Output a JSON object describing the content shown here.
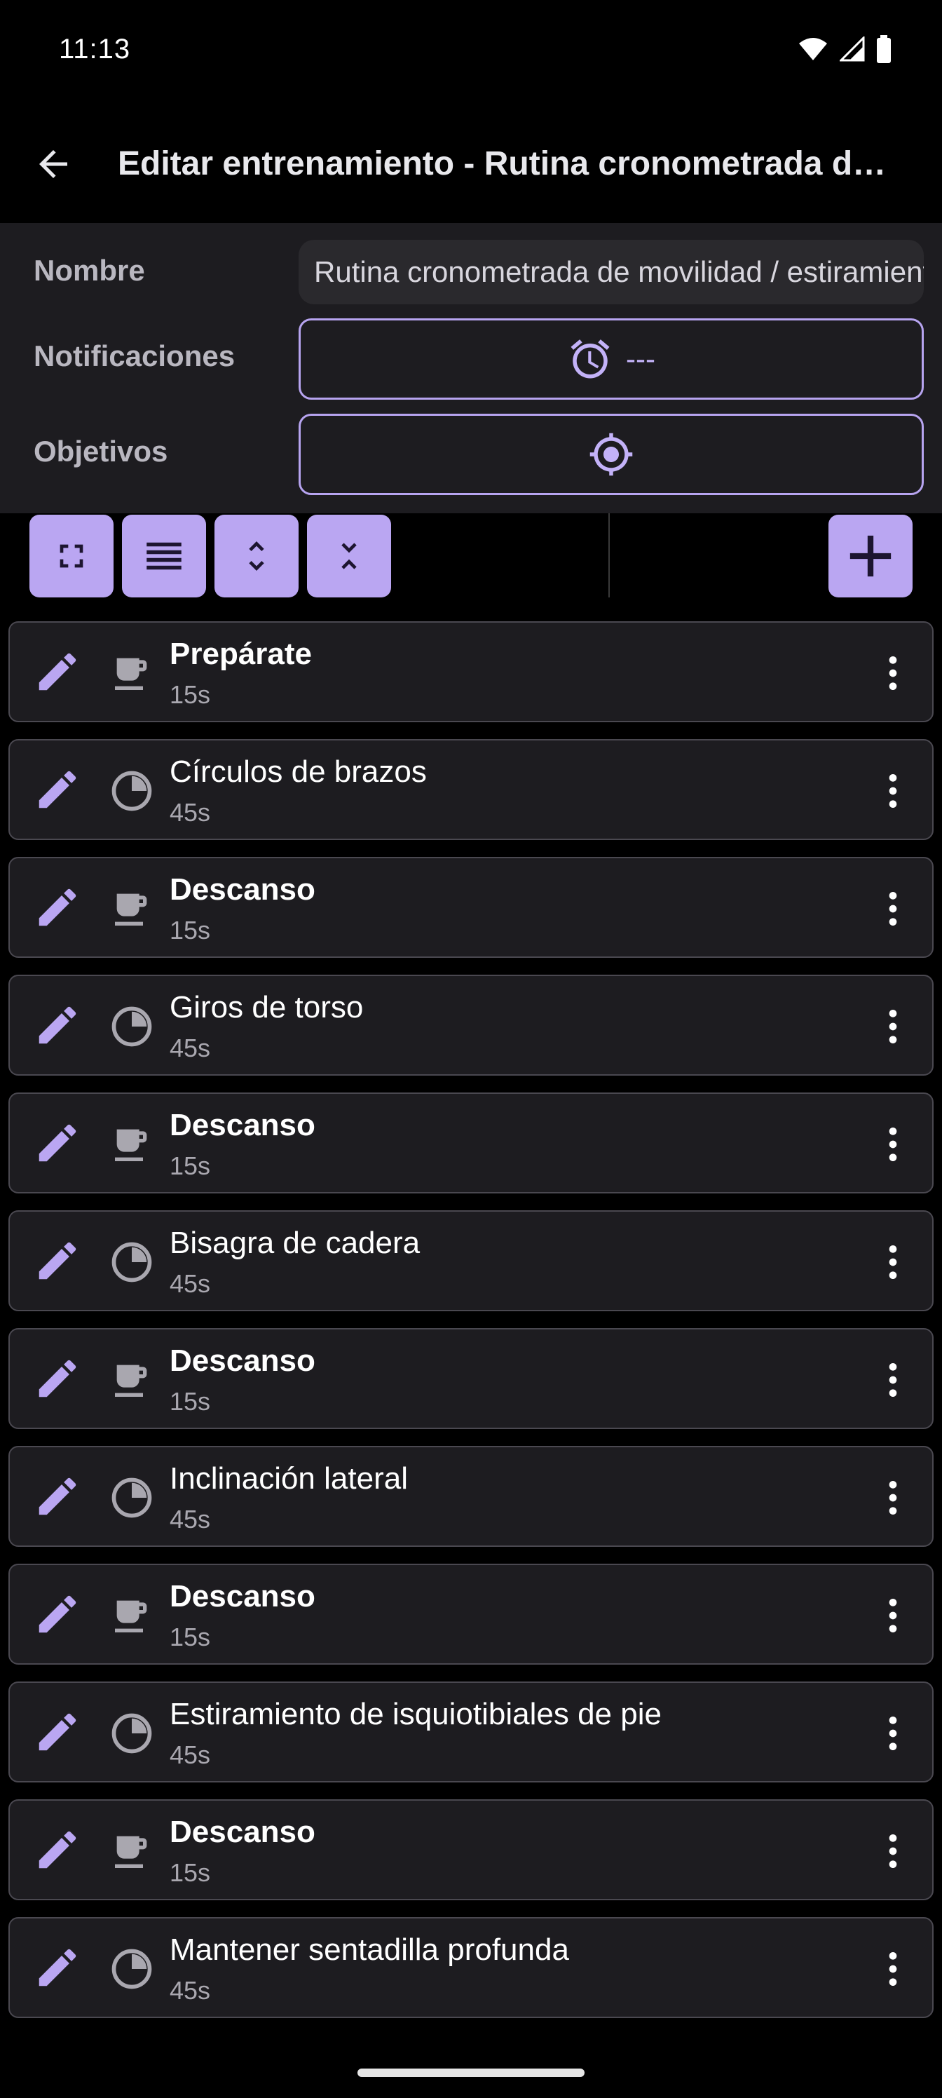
{
  "status_bar": {
    "time": "11:13"
  },
  "app_bar": {
    "back_icon": "arrow-back-icon",
    "title": "Editar entrenamiento - Rutina cronometrada de movilidad / estiramiento"
  },
  "form": {
    "name_label": "Nombre",
    "name_value": "Rutina cronometrada de movilidad / estiramiento",
    "notifications_label": "Notificaciones",
    "notifications_value": "---",
    "notifications_icon": "alarm-icon",
    "goals_label": "Objetivos",
    "goals_icon": "target-icon"
  },
  "toolbar": {
    "buttons": [
      "fullscreen-icon",
      "list-icon",
      "expand-icon",
      "collapse-icon"
    ],
    "add_icon": "add-icon"
  },
  "colors": {
    "accent": "#baa6f2",
    "surface": "#1d1c20",
    "background": "#000000"
  },
  "steps": [
    {
      "title": "Prepárate",
      "duration": "15s",
      "type": "rest",
      "bold": true
    },
    {
      "title": "Círculos de brazos",
      "duration": "45s",
      "type": "timer",
      "bold": false
    },
    {
      "title": "Descanso",
      "duration": "15s",
      "type": "rest",
      "bold": true
    },
    {
      "title": "Giros de torso",
      "duration": "45s",
      "type": "timer",
      "bold": false
    },
    {
      "title": "Descanso",
      "duration": "15s",
      "type": "rest",
      "bold": true
    },
    {
      "title": "Bisagra de cadera",
      "duration": "45s",
      "type": "timer",
      "bold": false
    },
    {
      "title": "Descanso",
      "duration": "15s",
      "type": "rest",
      "bold": true
    },
    {
      "title": "Inclinación lateral",
      "duration": "45s",
      "type": "timer",
      "bold": false
    },
    {
      "title": "Descanso",
      "duration": "15s",
      "type": "rest",
      "bold": true
    },
    {
      "title": "Estiramiento de isquiotibiales de pie",
      "duration": "45s",
      "type": "timer",
      "bold": false
    },
    {
      "title": "Descanso",
      "duration": "15s",
      "type": "rest",
      "bold": true
    },
    {
      "title": "Mantener sentadilla profunda",
      "duration": "45s",
      "type": "timer",
      "bold": false
    }
  ]
}
